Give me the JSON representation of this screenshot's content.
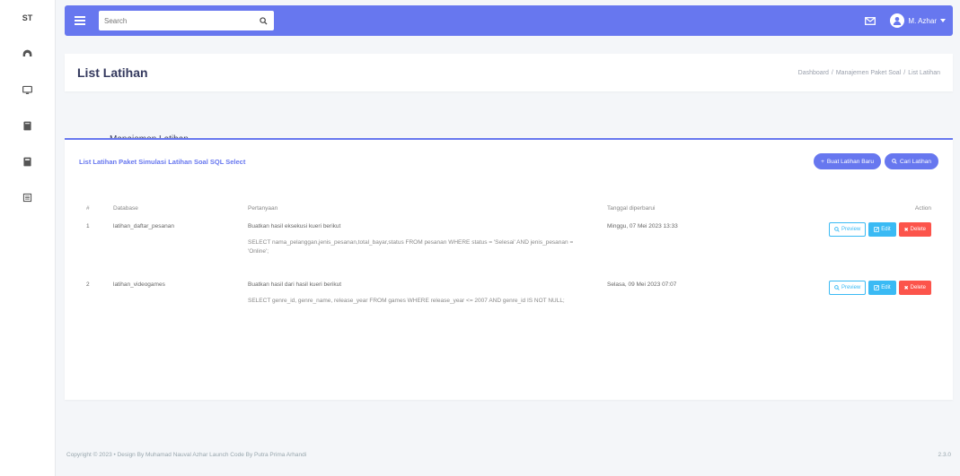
{
  "rail": {
    "brand": "ST"
  },
  "topbar": {
    "search_placeholder": "Search",
    "user_name": "M. Azhar"
  },
  "page": {
    "title": "List Latihan",
    "breadcrumb": [
      "Dashboard",
      "Manajemen Paket Soal",
      "List Latihan"
    ]
  },
  "section": {
    "title": "Manajemen Latihan"
  },
  "card": {
    "title": "List Latihan Paket Simulasi Latihan Soal SQL Select",
    "add_button": "Buat Latihan Baru",
    "find_button": "Cari Latihan"
  },
  "table": {
    "headers": [
      "#",
      "Database",
      "Pertanyaan",
      "Tanggal diperbarui",
      "Action"
    ],
    "rows": [
      {
        "num": "1",
        "database": "latihan_daftar_pesanan",
        "question": "Buatkan hasil eksekusi kueri berikut",
        "sql": "SELECT nama_pelanggan,jenis_pesanan,total_bayar,status FROM pesanan WHERE status = 'Selesai' AND jenis_pesanan = 'Online';",
        "date": "Minggu, 07 Mei 2023 13:33"
      },
      {
        "num": "2",
        "database": "latihan_videogames",
        "question": "Buatkan hasil dari hasil kueri berikut",
        "sql": "SELECT genre_id, genre_name, release_year FROM games WHERE release_year <= 2007 AND genre_id IS NOT NULL;",
        "date": "Selasa, 09 Mei 2023 07:07"
      }
    ],
    "actions": {
      "preview": "Preview",
      "edit": "Edit",
      "delete": "Delete"
    }
  },
  "footer": {
    "copyright": "Copyright © 2023 • Design By Muhamad Nauval Azhar Launch Code By Putra Prima Arhandi",
    "version": "2.3.0"
  },
  "colors": {
    "primary": "#6777ef",
    "info": "#3abaf4",
    "danger": "#fc544b",
    "background": "#f4f6f9"
  }
}
